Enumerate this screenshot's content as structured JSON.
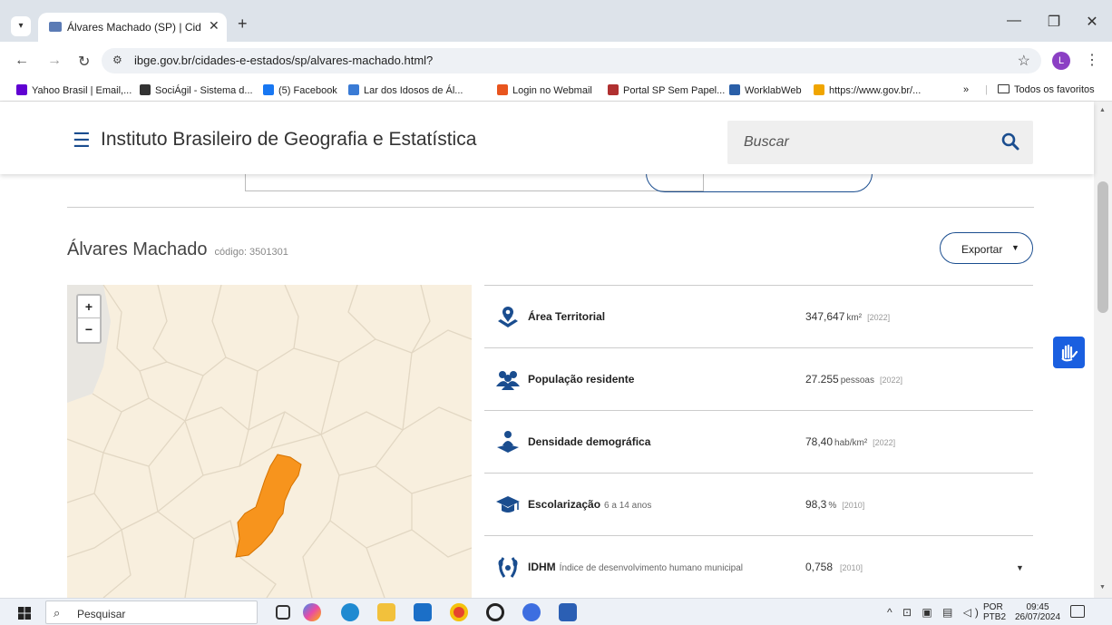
{
  "browser": {
    "tab_title": "Álvares Machado (SP) | Cidades",
    "new_tab_symbol": "+",
    "url": "ibge.gov.br/cidades-e-estados/sp/alvares-machado.html?",
    "profile_initial": "L",
    "bookmarks": [
      {
        "label": "Yahoo Brasil | Email,...",
        "color": "#6001d2"
      },
      {
        "label": "SociÁgil - Sistema d...",
        "color": "#333333"
      },
      {
        "label": "(5) Facebook",
        "color": "#1877f2"
      },
      {
        "label": "Lar dos Idosos de Ál...",
        "color": "#3a7bd5"
      },
      {
        "label": "Login no Webmail",
        "color": "#e8551e"
      },
      {
        "label": "Portal SP Sem Papel...",
        "color": "#b03030"
      },
      {
        "label": "WorklabWeb",
        "color": "#2a5fa8"
      },
      {
        "label": "https://www.gov.br/...",
        "color": "#f0a500"
      }
    ],
    "bookmarks_more": "»",
    "all_bookmarks": "Todos os favoritos"
  },
  "header": {
    "title": "Instituto Brasileiro de Geografia e Estatística",
    "search_placeholder": "Buscar"
  },
  "municipality": {
    "name": "Álvares Machado",
    "code": "código: 3501301",
    "export_label": "Exportar"
  },
  "indicators": [
    {
      "name": "Área Territorial",
      "desc": "",
      "value": "347,647",
      "unit": "km²",
      "year": "[2022]",
      "icon": "location-pin-icon"
    },
    {
      "name": "População residente",
      "desc": "",
      "value": "27.255",
      "unit": "pessoas",
      "year": "[2022]",
      "icon": "people-icon"
    },
    {
      "name": "Densidade demográfica",
      "desc": "",
      "value": "78,40",
      "unit": "hab/km²",
      "year": "[2022]",
      "icon": "person-area-icon"
    },
    {
      "name": "Escolarização",
      "desc": "6 a 14 anos",
      "value": "98,3",
      "unit": "%",
      "year": "[2010]",
      "icon": "graduation-cap-icon"
    },
    {
      "name": "IDHM",
      "desc": "Índice de desenvolvimento humano municipal",
      "value": "0,758",
      "unit": "",
      "year": "[2010]",
      "icon": "laurel-icon"
    }
  ],
  "map": {
    "zoom_in": "+",
    "zoom_out": "−",
    "highlight_color": "#f7941d",
    "background_color": "#f8efde"
  },
  "taskbar": {
    "search_text": "Pesquisar",
    "lang_line1": "POR",
    "lang_line2": "PTB2",
    "time": "09:45",
    "date": "26/07/2024"
  }
}
